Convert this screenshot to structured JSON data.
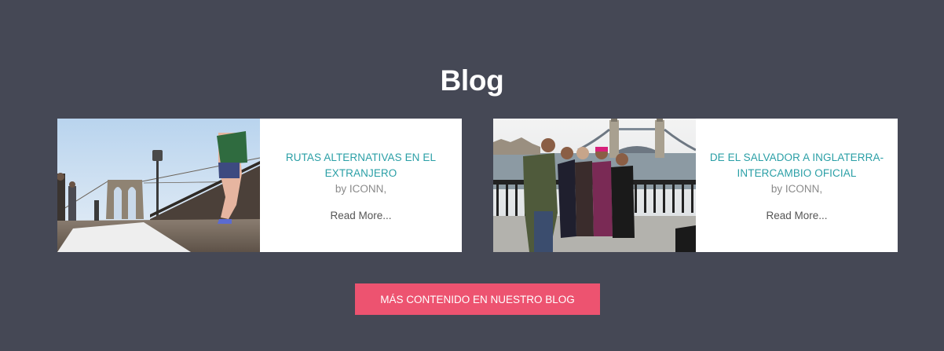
{
  "section": {
    "title": "Blog"
  },
  "posts": [
    {
      "title": "RUTAS ALTERNATIVAS EN EL EXTRANJERO",
      "author": "by ICONN,",
      "read_more": "Read More...",
      "image_icon": "bridge-photo"
    },
    {
      "title": "DE EL SALVADOR A INGLATERRA- INTERCAMBIO OFICIAL",
      "author": "by ICONN,",
      "read_more": "Read More...",
      "image_icon": "tower-bridge-group-photo"
    }
  ],
  "cta": {
    "label": "MÁS CONTENIDO EN NUESTRO BLOG"
  },
  "colors": {
    "background": "#454855",
    "card": "#ffffff",
    "title_accent": "#2a9fa6",
    "button": "#ed5370"
  }
}
